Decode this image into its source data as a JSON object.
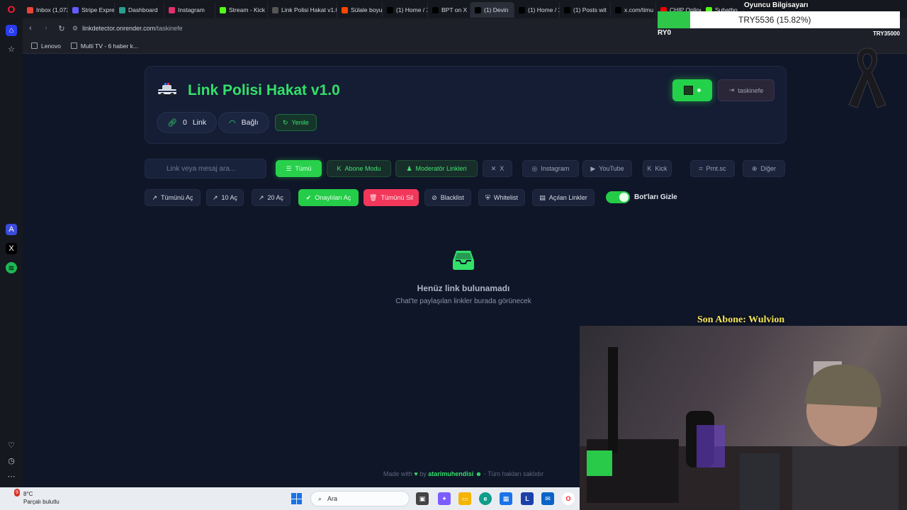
{
  "browser": {
    "tabs": [
      {
        "label": "Inbox (1,072",
        "icon": "gmail-icon",
        "color": "#ea4335"
      },
      {
        "label": "Stripe Expres",
        "icon": "stripe-icon",
        "color": "#635bff"
      },
      {
        "label": "Dashboard",
        "icon": "dashboard-icon",
        "color": "#2a9d8f"
      },
      {
        "label": "Instagram",
        "icon": "instagram-icon",
        "color": "#e1306c"
      },
      {
        "label": "Stream - Kick",
        "icon": "kick-icon",
        "color": "#53fc18"
      },
      {
        "label": "Link Polisi Hakat v1.0",
        "icon": "police-icon",
        "color": "#555"
      },
      {
        "label": "Sülale boyu",
        "icon": "reddit-icon",
        "color": "#ff4500"
      },
      {
        "label": "(1) Home / X",
        "icon": "x-icon",
        "color": "#000"
      },
      {
        "label": "BPT on X",
        "icon": "x-icon",
        "color": "#000"
      },
      {
        "label": "(1) Devin",
        "icon": "x-icon",
        "color": "#000"
      },
      {
        "label": "(1) Home / X",
        "icon": "x-icon",
        "color": "#000"
      },
      {
        "label": "(1) Posts wit",
        "icon": "x-icon",
        "color": "#000"
      },
      {
        "label": "x.com/timu",
        "icon": "x-icon",
        "color": "#000"
      },
      {
        "label": "CHIP Online",
        "icon": "chip-icon",
        "color": "#e00"
      },
      {
        "label": "Şubatbo",
        "icon": "kick-icon",
        "color": "#53fc18"
      }
    ],
    "url_host": "linkdetector.onrender.com",
    "url_path": "/taskinefe",
    "bookmarks": [
      "Lenovo",
      "Multi TV - 6 haber k..."
    ]
  },
  "app": {
    "title": "Link Polisi Hakat v1.0",
    "link_count": "0",
    "link_label": "Link",
    "status": "Bağlı",
    "refresh_label": "Yenile",
    "logout_label": "taskinefe",
    "accent": "#33e06a"
  },
  "search": {
    "placeholder": "Link veya mesaj ara..."
  },
  "filters": [
    {
      "label": "Tümü",
      "icon": "list-icon"
    },
    {
      "label": "Abone Modu",
      "icon": "kick-icon"
    },
    {
      "label": "Moderatör Linkleri",
      "icon": "user-shield-icon"
    },
    {
      "label": "X",
      "icon": "x-icon"
    },
    {
      "label": "Instagram",
      "icon": "instagram-icon"
    },
    {
      "label": "YouTube",
      "icon": "youtube-icon"
    },
    {
      "label": "Kick",
      "icon": "kick-icon"
    },
    {
      "label": "Prnt.sc",
      "icon": "camera-icon"
    },
    {
      "label": "Diğer",
      "icon": "globe-icon"
    }
  ],
  "actions": [
    {
      "label": "Tümünü Aç",
      "icon": "external-link-icon"
    },
    {
      "label": "10 Aç",
      "icon": "external-link-icon"
    },
    {
      "label": "20 Aç",
      "icon": "external-link-icon"
    },
    {
      "label": "Onaylıları Aç",
      "icon": "check-circle-icon"
    },
    {
      "label": "Tümünü Sil",
      "icon": "trash-icon"
    },
    {
      "label": "Blacklist",
      "icon": "ban-icon"
    },
    {
      "label": "Whitelist",
      "icon": "shield-icon"
    },
    {
      "label": "Açılan Linkler",
      "icon": "history-icon"
    }
  ],
  "toggle": {
    "label": "Bot'ları Gizle",
    "on": true
  },
  "empty": {
    "title": "Henüz link bulunamadı",
    "subtitle": "Chat'te paylaşılan linkler burada görünecek"
  },
  "footer": {
    "made_with": "Made with",
    "by": "by",
    "author": "atarimuhendisi",
    "rights": "- Tüm hakları saklıdır"
  },
  "overlay": {
    "top_label": "Oyuncu Bilgisayarı",
    "ticker": "TRY5536 (15.82%)",
    "left_label": "RY0",
    "right_label": "TRY35000",
    "last_sub": "Son Abone: Wulvion"
  },
  "taskbar": {
    "temperature": "8°C",
    "weather": "Parçalı bulutlu",
    "search_placeholder": "Ara",
    "weather_badge": "9"
  }
}
